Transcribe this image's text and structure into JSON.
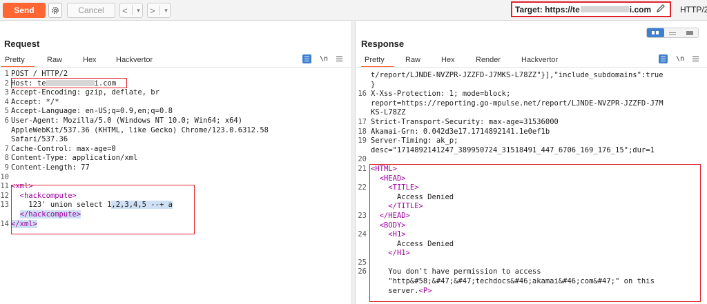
{
  "toolbar": {
    "send_label": "Send",
    "cancel_label": "Cancel",
    "prev_symbol": "<",
    "next_symbol": ">",
    "dropdown_symbol": "▾",
    "target_prefix": "Target: https://te",
    "target_suffix": "i.com",
    "http_version": "HTTP/2"
  },
  "request": {
    "title": "Request",
    "tabs": [
      "Pretty",
      "Raw",
      "Hex",
      "Hackvertor"
    ],
    "icon_n": "\\n",
    "lines": [
      {
        "n": "1",
        "text": "POST / HTTP/2"
      },
      {
        "n": "2",
        "name": "Host:",
        "value": " te",
        "suffix": "i.com"
      },
      {
        "n": "3",
        "name": "Accept-Encoding:",
        "value": " gzip, deflate, br"
      },
      {
        "n": "4",
        "name": "Accept:",
        "value": " */*"
      },
      {
        "n": "5",
        "name": "Accept-Language:",
        "value": " en-US;q=0.9,en;q=0.8"
      },
      {
        "n": "6",
        "name": "User-Agent:",
        "value": " Mozilla/5.0 (Windows NT 10.0; Win64; x64)"
      },
      {
        "n": "",
        "text": "AppleWebKit/537.36 (KHTML, like Gecko) Chrome/123.0.6312.58"
      },
      {
        "n": "",
        "text": "Safari/537.36"
      },
      {
        "n": "7",
        "name": "Cache-Control:",
        "value": " max-age=0"
      },
      {
        "n": "8",
        "name": "Content-Type:",
        "value": " application/xml"
      },
      {
        "n": "9",
        "name": "Content-Length:",
        "value": " 77"
      },
      {
        "n": "10",
        "text": ""
      },
      {
        "n": "11",
        "tag": "<xml>"
      },
      {
        "n": "12",
        "indent": "  ",
        "tag": "<hackcompute>"
      },
      {
        "n": "13",
        "text": "    123' union select 1",
        "hl": ",2,3,4,5 --+ a"
      },
      {
        "n": "",
        "indent": "  ",
        "tag": "</hackcompute>",
        "hlrow": true
      },
      {
        "n": "14",
        "tag": "</xml>",
        "hlrow": true
      }
    ]
  },
  "response": {
    "title": "Response",
    "tabs": [
      "Pretty",
      "Raw",
      "Hex",
      "Render",
      "Hackvertor"
    ],
    "icon_n": "\\n",
    "lines": [
      {
        "n": "",
        "text": "t/report/LJNDE-NVZPR-JZZFD-J7MKS-L78ZZ\"}],\"include_subdomains\":true"
      },
      {
        "n": "",
        "text": "}"
      },
      {
        "n": "16",
        "name": "X-Xss-Protection:",
        "value": " 1; mode=block;"
      },
      {
        "n": "",
        "text": "report=https://reporting.go-mpulse.net/report/LJNDE-NVZPR-JZZFD-J7M"
      },
      {
        "n": "",
        "text": "KS-L78ZZ"
      },
      {
        "n": "17",
        "name": "Strict-Transport-Security:",
        "value": " max-age=31536000"
      },
      {
        "n": "18",
        "name": "Akamai-Grn:",
        "value": " 0.042d3e17.1714892141.1e0ef1b"
      },
      {
        "n": "19",
        "name": "Server-Timing:",
        "value": " ak_p;"
      },
      {
        "n": "",
        "text": "desc=\"1714892141247_389950724_31518491_447_6706_169_176_15\";dur=1"
      },
      {
        "n": "20",
        "text": ""
      },
      {
        "n": "21",
        "tag": "<HTML>"
      },
      {
        "n": "",
        "indent": "  ",
        "tag": "<HEAD>"
      },
      {
        "n": "22",
        "indent": "    ",
        "tag": "<TITLE>"
      },
      {
        "n": "",
        "text": "      Access Denied"
      },
      {
        "n": "",
        "indent": "    ",
        "tag": "</TITLE>"
      },
      {
        "n": "23",
        "indent": "  ",
        "tag": "</HEAD>"
      },
      {
        "n": "",
        "indent": "  ",
        "tag": "<BODY>"
      },
      {
        "n": "24",
        "indent": "    ",
        "tag": "<H1>"
      },
      {
        "n": "",
        "text": "      Access Denied"
      },
      {
        "n": "",
        "indent": "    ",
        "tag": "</H1>"
      },
      {
        "n": "25",
        "text": ""
      },
      {
        "n": "26",
        "text": "    You don't have permission to access"
      },
      {
        "n": "",
        "text": "    \"http&#58;&#47;&#47;techdocs&#46;akamai&#46;com&#47;\" on this"
      },
      {
        "n": "",
        "text": "    server.",
        "tag": "<P>"
      }
    ]
  },
  "colors": {
    "send": "#ff6633",
    "highlight_box": "#e0202a",
    "tag": "#a000a0",
    "selection": "#cfe0f5"
  },
  "icons": [
    "gear-icon",
    "pencil-icon",
    "layout-split-icon",
    "layout-rows-icon",
    "layout-single-icon",
    "pretty-toggle-icon",
    "newline-toggle-icon",
    "menu-icon"
  ]
}
